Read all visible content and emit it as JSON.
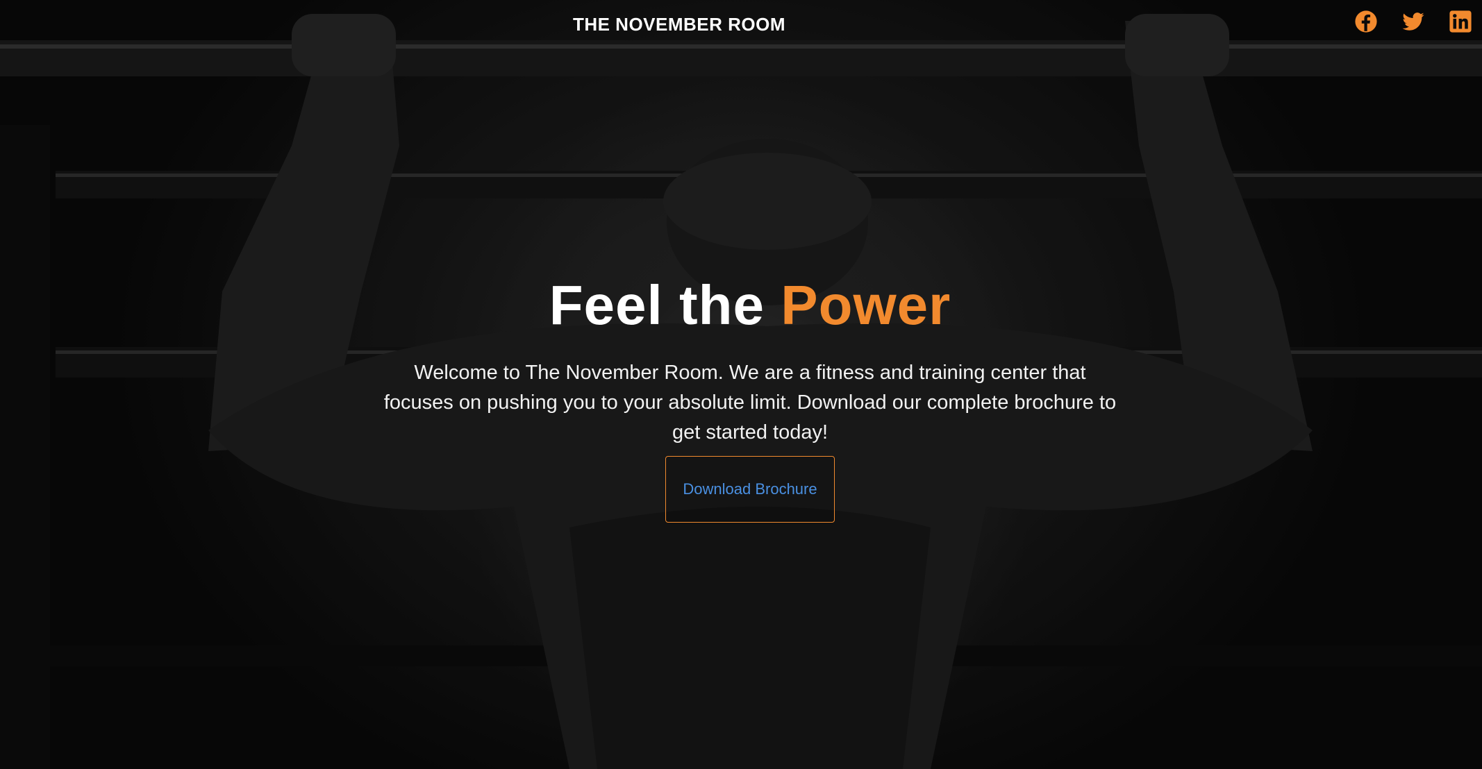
{
  "header": {
    "brand": "THE NOVEMBER ROOM"
  },
  "social": {
    "color": "#f28a2e",
    "icons": [
      "facebook-icon",
      "twitter-icon",
      "linkedin-icon"
    ]
  },
  "hero": {
    "headline_prefix": "Feel the ",
    "headline_accent": "Power",
    "accent_color": "#f28a2e",
    "description": "Welcome to The November Room. We are a fitness and training center that focuses on pushing you to your absolute limit. Download our complete brochure to get started today!",
    "cta_label": "Download Brochure",
    "cta_text_color": "#4a90e2"
  }
}
